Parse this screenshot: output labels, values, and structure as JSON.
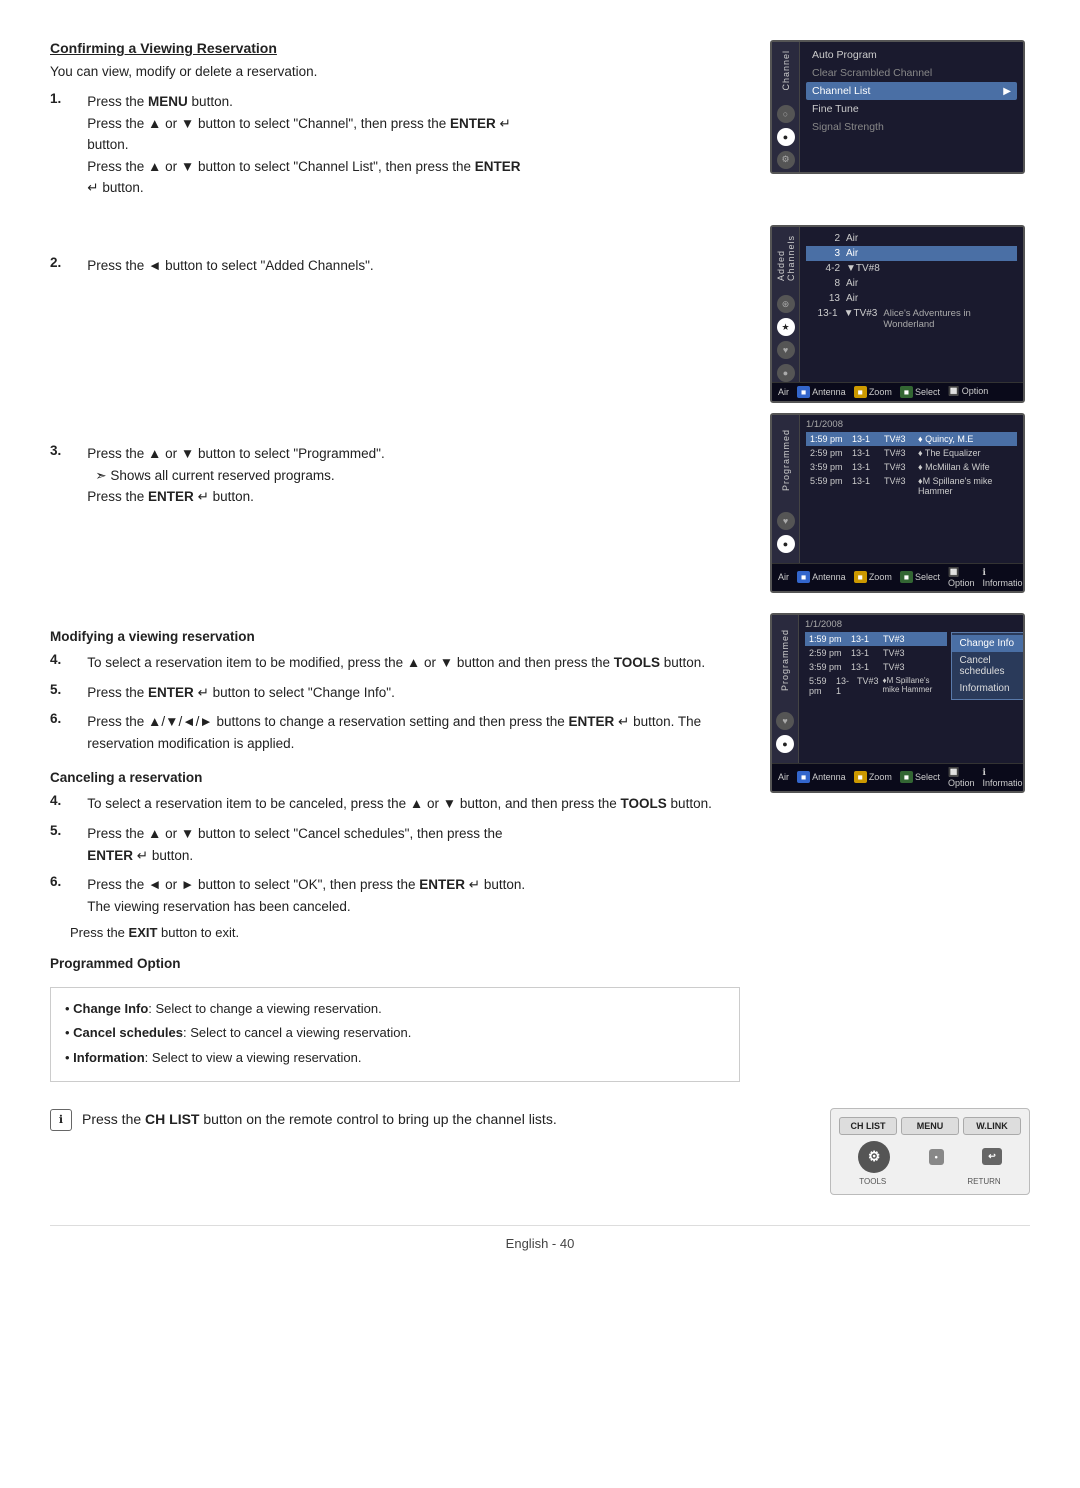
{
  "page": {
    "title": "Confirming a Viewing Reservation",
    "intro": "You can view, modify or delete a reservation.",
    "footer": "English - 40"
  },
  "steps": {
    "step1": {
      "number": "1.",
      "lines": [
        "Press the MENU button.",
        "Press the ▲ or ▼ button to select \"Channel\", then press the ENTER ↵ button.",
        "Press the ▲ or ▼ button to select \"Channel List\", then press the ENTER ↵ button."
      ]
    },
    "step2": {
      "number": "2.",
      "text": "Press the ◄ button to select \"Added Channels\"."
    },
    "step3": {
      "number": "3.",
      "lines": [
        "Press the ▲ or ▼ button to select \"Programmed\".",
        "➣  Shows all current reserved programs.",
        "Press the ENTER ↵ button."
      ]
    }
  },
  "modifying_section": {
    "title": "Modifying a viewing reservation",
    "step4": {
      "number": "4.",
      "text": "To select a reservation item to be modified, press the ▲ or ▼ button and then press the TOOLS button."
    },
    "step5": {
      "number": "5.",
      "text": "Press the ENTER ↵ button to select \"Change Info\"."
    },
    "step6": {
      "number": "6.",
      "text": "Press the ▲/▼/◄/► buttons to change a reservation setting and then press the ENTER ↵ button. The reservation modification is applied."
    }
  },
  "canceling_section": {
    "title": "Canceling a reservation",
    "step4": {
      "number": "4.",
      "text": "To select a reservation item to be canceled, press the ▲ or ▼ button, and then press the TOOLS button."
    },
    "step5": {
      "number": "5.",
      "text": "Press the ▲ or ▼ button to select \"Cancel schedules\", then press the ENTER ↵ button."
    },
    "step6": {
      "number": "6.",
      "text": "Press the ◄ or ► button to select \"OK\", then press the ENTER ↵ button. The viewing reservation has been canceled."
    },
    "exit": "Press the EXIT button to exit."
  },
  "programmed_option": {
    "title": "Programmed Option",
    "items": [
      {
        "bold": "Change Info",
        "rest": ": Select to change a viewing reservation."
      },
      {
        "bold": "Cancel schedules",
        "rest": ": Select to cancel a viewing reservation."
      },
      {
        "bold": "Information",
        "rest": ": Select to view a viewing reservation."
      }
    ]
  },
  "tip": {
    "icon": "ℹ",
    "text": "Press the CH LIST button on the remote control to bring up the channel lists."
  },
  "screen1": {
    "sidebar_label": "Channel",
    "items": [
      {
        "label": "Auto Program",
        "type": "normal"
      },
      {
        "label": "Clear Scrambled Channel",
        "type": "dimmed"
      },
      {
        "label": "Channel List",
        "type": "highlighted"
      },
      {
        "label": "Fine Tune",
        "type": "normal"
      },
      {
        "label": "Signal Strength",
        "type": "dimmed"
      }
    ]
  },
  "screen2": {
    "sidebar_label": "Added Channels",
    "channels": [
      {
        "num": "2",
        "name": "Air",
        "desc": ""
      },
      {
        "num": "3",
        "name": "Air",
        "desc": "",
        "selected": true
      },
      {
        "num": "4-2",
        "name": "▼TV#8",
        "desc": ""
      },
      {
        "num": "8",
        "name": "Air",
        "desc": ""
      },
      {
        "num": "13",
        "name": "Air",
        "desc": ""
      },
      {
        "num": "13-1",
        "name": "▼TV#3",
        "desc": "Alice's Adventures in Wonderland"
      }
    ],
    "bottom": "Air  Antenna  Zoom  Select  Option"
  },
  "screen3": {
    "sidebar_label": "Programmed",
    "date": "1/1/2008",
    "programs": [
      {
        "time": "1:59 pm",
        "ch": "13-1",
        "network": "TV#3",
        "show": "♦ Quincy, M.E",
        "selected": true
      },
      {
        "time": "2:59 pm",
        "ch": "13-1",
        "network": "TV#3",
        "show": "♦ The Equalizer"
      },
      {
        "time": "3:59 pm",
        "ch": "13-1",
        "network": "TV#3",
        "show": "♦ McMillan & Wife"
      },
      {
        "time": "5:59 pm",
        "ch": "13-1",
        "network": "TV#3",
        "show": "♦M Spillane's mike Hammer"
      }
    ],
    "bottom": "Air  Antenna  Zoom  Select  Option  Information"
  },
  "screen4": {
    "sidebar_label": "Programmed",
    "date": "1/1/2008",
    "programs": [
      {
        "time": "1:59 pm",
        "ch": "13-1",
        "network": "TV#3",
        "selected": true
      },
      {
        "time": "2:59 pm",
        "ch": "13-1",
        "network": "TV#3"
      },
      {
        "time": "3:59 pm",
        "ch": "13-1",
        "network": "TV#3"
      },
      {
        "time": "5:59 pm",
        "ch": "13-1",
        "network": "TV#3",
        "show": "♦M Spillane's mike Hammer"
      }
    ],
    "context_menu": [
      {
        "label": "Change Info",
        "selected": true
      },
      {
        "label": "Cancel schedules"
      },
      {
        "label": "Information"
      }
    ],
    "bottom": "Air  Antenna  Zoom  Select  Option  Information"
  },
  "remote": {
    "buttons": [
      "CH LIST",
      "MENU",
      "W.LINK"
    ],
    "tools_label": "TOOLS",
    "return_label": "RETURN"
  }
}
